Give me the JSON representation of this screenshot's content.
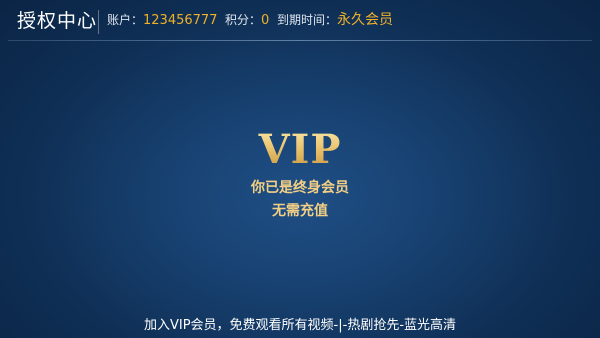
{
  "header": {
    "title": "授权中心",
    "account_label": "账户：",
    "account_value": "123456777",
    "points_label": "积分：",
    "points_value": "0",
    "expire_label": "到期时间：",
    "expire_value": "永久会员"
  },
  "main": {
    "vip_title": "VIP",
    "status_line1": "你已是终身会员",
    "status_line2": "无需充值"
  },
  "footer": {
    "promo_text": "加入VIP会员，免费观看所有视频-|-热剧抢先-蓝光高清"
  },
  "colors": {
    "accent_gold": "#f0b129",
    "vip_gold": "#e8c46c",
    "background_dark": "#0a2444",
    "background_light": "#1f4f86"
  }
}
